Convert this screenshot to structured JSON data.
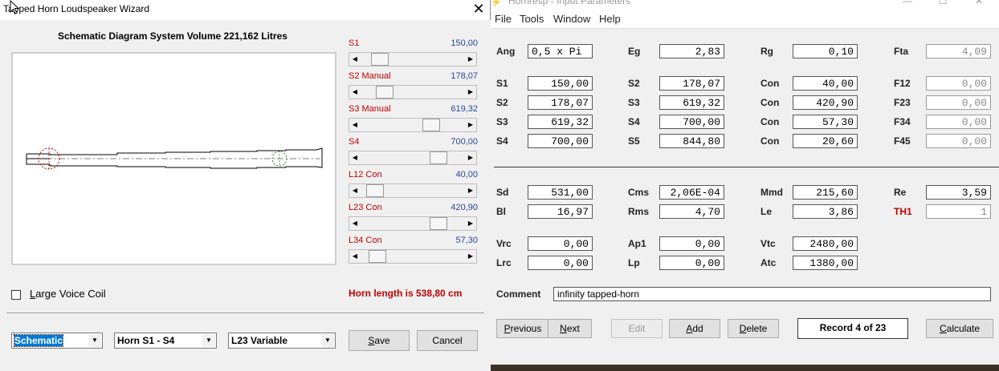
{
  "background_window": {
    "title": "Hornresp - Input Parameters",
    "menu": [
      "File",
      "Tools",
      "Window",
      "Help"
    ],
    "top_section": {
      "rows": [
        [
          {
            "label": "Ang",
            "value": "0,5 x Pi",
            "align": "left"
          },
          {
            "label": "Eg",
            "value": "2,83"
          },
          {
            "label": "Rg",
            "value": "0,10"
          },
          {
            "label": "Fta",
            "value": "4,09",
            "gray": true
          }
        ],
        [
          {
            "label": "S1",
            "value": "150,00"
          },
          {
            "label": "S2",
            "value": "178,07"
          },
          {
            "label": "Con",
            "value": "40,00"
          },
          {
            "label": "F12",
            "value": "0,00",
            "gray": true
          }
        ],
        [
          {
            "label": "S2",
            "value": "178,07"
          },
          {
            "label": "S3",
            "value": "619,32"
          },
          {
            "label": "Con",
            "value": "420,90"
          },
          {
            "label": "F23",
            "value": "0,00",
            "gray": true
          }
        ],
        [
          {
            "label": "S3",
            "value": "619,32"
          },
          {
            "label": "S4",
            "value": "700,00"
          },
          {
            "label": "Con",
            "value": "57,30"
          },
          {
            "label": "F34",
            "value": "0,00",
            "gray": true
          }
        ],
        [
          {
            "label": "S4",
            "value": "700,00"
          },
          {
            "label": "S5",
            "value": "844,80"
          },
          {
            "label": "Con",
            "value": "20,60"
          },
          {
            "label": "F45",
            "value": "0,00",
            "gray": true
          }
        ]
      ]
    },
    "driver_section": {
      "rows": [
        [
          {
            "label": "Sd",
            "value": "531,00"
          },
          {
            "label": "Cms",
            "value": "2,06E-04"
          },
          {
            "label": "Mmd",
            "value": "215,60"
          },
          {
            "label": "Re",
            "value": "3,59"
          }
        ],
        [
          {
            "label": "Bl",
            "value": "16,97"
          },
          {
            "label": "Rms",
            "value": "4,70"
          },
          {
            "label": "Le",
            "value": "3,86"
          },
          {
            "label": "TH1",
            "value": "1",
            "gray": true,
            "red": true
          }
        ]
      ]
    },
    "chamber_section": {
      "rows": [
        [
          {
            "label": "Vrc",
            "value": "0,00"
          },
          {
            "label": "Ap1",
            "value": "0,00"
          },
          {
            "label": "Vtc",
            "value": "2480,00"
          }
        ],
        [
          {
            "label": "Lrc",
            "value": "0,00"
          },
          {
            "label": "Lp",
            "value": "0,00"
          },
          {
            "label": "Atc",
            "value": "1380,00"
          }
        ]
      ]
    },
    "comment_label": "Comment",
    "comment_value": "infinity tapped-horn",
    "buttons": {
      "previous": "Previous",
      "next": "Next",
      "edit": "Edit",
      "add": "Add",
      "delete": "Delete",
      "calculate": "Calculate"
    },
    "record": "Record 4 of 23",
    "window_controls": {
      "minimize": "—",
      "maximize": "☐",
      "close": "✕"
    }
  },
  "wizard": {
    "title": "Tapped Horn Loudspeaker Wizard",
    "close": "✕",
    "schematic_title": "Schematic Diagram   System Volume 221,162 Litres",
    "sliders": [
      {
        "label": "S1",
        "value": "150,00",
        "position": 0.12
      },
      {
        "label": "S2  Manual",
        "value": "178,07",
        "position": 0.17
      },
      {
        "label": "S3  Manual",
        "value": "619,32",
        "position": 0.7
      },
      {
        "label": "S4",
        "value": "700,00",
        "position": 0.78
      },
      {
        "label": "L12  Con",
        "value": "40,00",
        "position": 0.06
      },
      {
        "label": "L23  Con",
        "value": "420,90",
        "position": 0.78
      },
      {
        "label": "L34  Con",
        "value": "57,30",
        "position": 0.09
      }
    ],
    "large_voice_coil": "Large Voice Coil",
    "horn_length": "Horn length is 538,80 cm",
    "combos": [
      "Schematic",
      "Horn S1 - S4",
      "L23 Variable"
    ],
    "save": "Save",
    "cancel": "Cancel"
  },
  "icons": [
    "app-icon",
    "close-icon",
    "minimize-icon",
    "maximize-icon",
    "chevron-left-icon",
    "chevron-right-icon",
    "chevron-down-icon",
    "mouse-cursor-icon"
  ]
}
